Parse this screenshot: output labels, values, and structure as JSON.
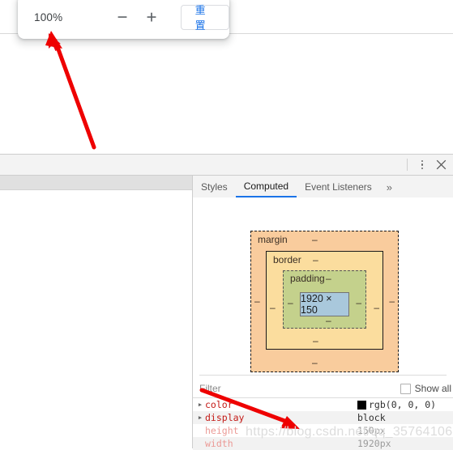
{
  "zoom_popup": {
    "level": "100%",
    "minus_label": "−",
    "plus_label": "+",
    "reset_label": "重置"
  },
  "devtools": {
    "topbar": {
      "kebab_icon": "kebab-menu-icon",
      "close_icon": "close-icon"
    },
    "tabs": [
      {
        "label": "Styles",
        "active": false
      },
      {
        "label": "Computed",
        "active": true
      },
      {
        "label": "Event Listeners",
        "active": false
      }
    ],
    "tab_overflow_label": "»",
    "box_model": {
      "margin_label": "margin",
      "border_label": "border",
      "padding_label": "padding",
      "content_size": "1920 × 150",
      "dash": "–",
      "colors": {
        "margin": "#f9cc9d",
        "border": "#fbdd9e",
        "padding": "#c4d18c",
        "content": "#a9c8dc"
      }
    },
    "filter": {
      "placeholder": "Filter",
      "show_all_label": "Show all",
      "show_all_checked": false
    },
    "properties": [
      {
        "name": "color",
        "value": "rgb(0, 0, 0)",
        "expandable": true,
        "muted": false,
        "swatch": "#000000"
      },
      {
        "name": "display",
        "value": "block",
        "expandable": true,
        "muted": false,
        "swatch": null
      },
      {
        "name": "height",
        "value": "150px",
        "expandable": false,
        "muted": true,
        "swatch": null
      },
      {
        "name": "width",
        "value": "1920px",
        "expandable": false,
        "muted": true,
        "swatch": null
      }
    ]
  },
  "watermark": "https://blog.csdn.net/qq_35764106"
}
